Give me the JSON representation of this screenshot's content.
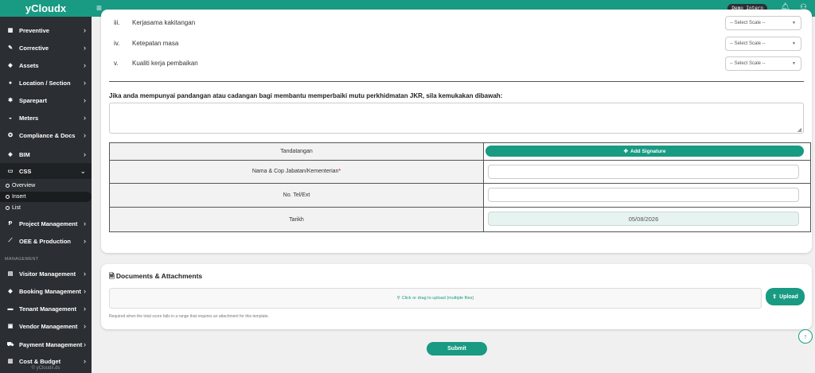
{
  "app": {
    "brand": "yCloudx",
    "user": "Demo Intern",
    "footer": "© yCloudx.ds"
  },
  "colors": {
    "accent": "#199a82",
    "sidebar": "#2b2f33",
    "highlight_border": "#cc0000"
  },
  "sidebar": {
    "items": [
      {
        "label": "Preventive",
        "icon": "calendar-icon"
      },
      {
        "label": "Corrective",
        "icon": "wrench-icon"
      },
      {
        "label": "Assets",
        "icon": "tag-icon"
      },
      {
        "label": "Location / Section",
        "icon": "location-icon"
      },
      {
        "label": "Sparepart",
        "icon": "gears-icon"
      },
      {
        "label": "Meters",
        "icon": "gauge-icon"
      },
      {
        "label": "Compliance & Docs",
        "icon": "badge-icon"
      },
      {
        "label": "BIM",
        "icon": "cube-icon"
      },
      {
        "label": "CSS",
        "icon": "css-icon"
      }
    ],
    "css_sub": [
      "Overview",
      "Insert",
      "List"
    ],
    "items2": [
      {
        "label": "Project Management",
        "icon": "project-icon"
      },
      {
        "label": "OEE & Production",
        "icon": "chart-icon"
      }
    ],
    "section_label": "MANAGEMENT",
    "items3": [
      {
        "label": "Visitor Management",
        "icon": "id-card-icon"
      },
      {
        "label": "Booking Management",
        "icon": "diamond-icon"
      },
      {
        "label": "Tenant Management",
        "icon": "tenant-icon"
      },
      {
        "label": "Vendor Management",
        "icon": "vendor-icon"
      },
      {
        "label": "Payment Management",
        "icon": "cart-icon"
      },
      {
        "label": "Cost & Budget",
        "icon": "wallet-icon"
      }
    ]
  },
  "form": {
    "rows": [
      {
        "num": "iii.",
        "label": "Kerjasama kakitangan",
        "select": "-- Select Scale --"
      },
      {
        "num": "iv.",
        "label": "Ketepatan masa",
        "select": "-- Select Scale --"
      },
      {
        "num": "v.",
        "label": "Kualiti kerja pembaikan",
        "select": "-- Select Scale --"
      }
    ],
    "feedback_question": "Jika anda mempunyai pandangan atau cadangan bagi membantu memperbaiki mutu perkhidmatan JKR, sila kemukakan dibawah:",
    "feedback_value": ""
  },
  "signature": {
    "label": "Tandatangan",
    "add_button": "Add Signature",
    "name_label": "Nama & Cop Jabatan/Kementerian",
    "required_mark": "*",
    "name_value": "",
    "tel_label": "No. Tel/Ext",
    "tel_value": "",
    "date_label": "Tarikh",
    "date_value": "05/08/2026"
  },
  "attachments": {
    "title": "Documents & Attachments",
    "dropzone": "Click or drag to upload (multiple files)",
    "upload_button": "Upload",
    "note": "Required when the total score falls in a range that requires an attachment for this template."
  },
  "actions": {
    "submit": "Submit"
  }
}
